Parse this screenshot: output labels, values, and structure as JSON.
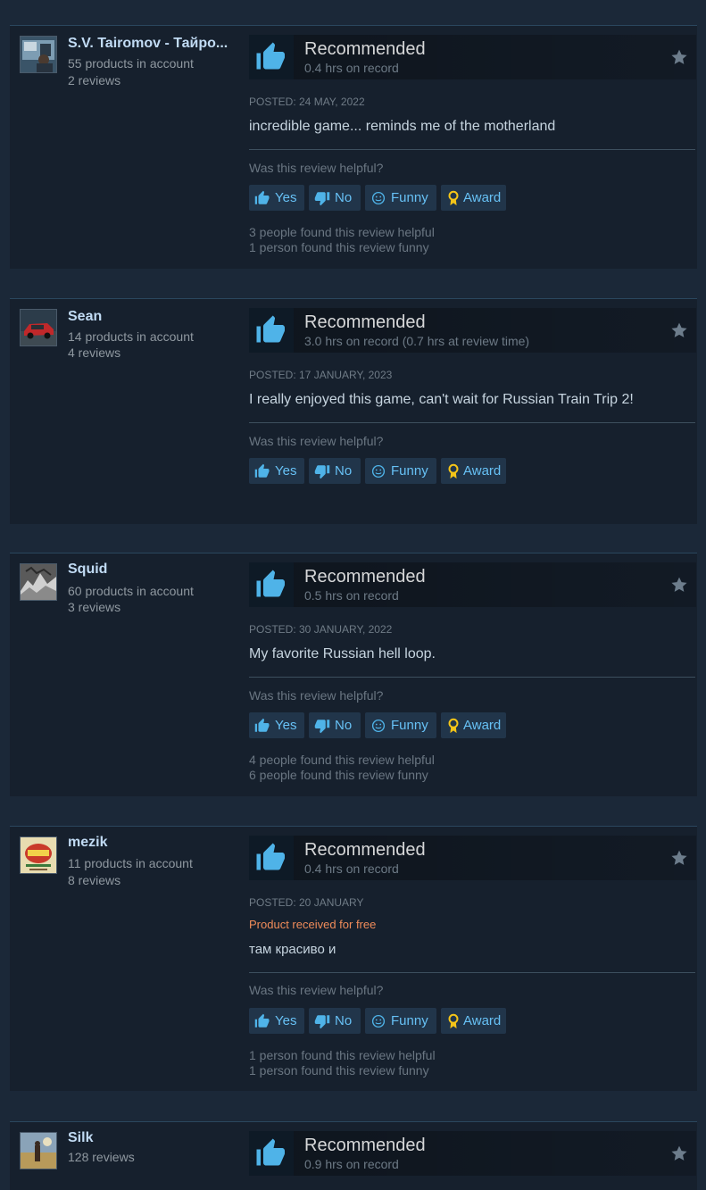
{
  "helpful_question": "Was this review helpful?",
  "vote_labels": {
    "yes": "Yes",
    "no": "No",
    "funny": "Funny",
    "award": "Award"
  },
  "reviews": [
    {
      "user_name": "S.V. Tairomov - Тайрo...",
      "products": "55 products in account",
      "reviews_count": "2 reviews",
      "verdict": "Recommended",
      "hours": "0.4 hrs on record",
      "posted": "POSTED: 24 MAY, 2022",
      "text": "incredible game... reminds me of the motherland",
      "helpful": "3 people found this review helpful",
      "funny": "1 person found this review funny"
    },
    {
      "user_name": "Sean",
      "products": "14 products in account",
      "reviews_count": "4 reviews",
      "verdict": "Recommended",
      "hours": "3.0 hrs on record (0.7 hrs at review time)",
      "posted": "POSTED: 17 JANUARY, 2023",
      "text": "I really enjoyed this game, can't wait for Russian Train Trip 2!"
    },
    {
      "user_name": "Squid",
      "products": "60 products in account",
      "reviews_count": "3 reviews",
      "verdict": "Recommended",
      "hours": "0.5 hrs on record",
      "posted": "POSTED: 30 JANUARY, 2022",
      "text": "My favorite Russian hell loop.",
      "helpful": "4 people found this review helpful",
      "funny": "6 people found this review funny"
    },
    {
      "user_name": "mezik",
      "products": "11 products in account",
      "reviews_count": "8 reviews",
      "verdict": "Recommended",
      "hours": "0.4 hrs on record",
      "posted": "POSTED: 20 JANUARY",
      "received_free": "Product received for free",
      "text": "там красиво и",
      "helpful": "1 person found this review helpful",
      "funny": "1 person found this review funny"
    },
    {
      "user_name": "Silk",
      "reviews_count": "128 reviews",
      "verdict": "Recommended",
      "hours": "0.9 hrs on record"
    }
  ],
  "colors": {
    "page_bg": "#1b2838",
    "card_bg": "#16202d",
    "link_blue": "#67c1f5",
    "thumb_blue": "#4fb3e8",
    "free_orange": "#f08c5a"
  },
  "icons": [
    "thumbs-up-icon",
    "thumbs-down-icon",
    "smiley-icon",
    "award-ribbon-icon",
    "star-icon"
  ]
}
